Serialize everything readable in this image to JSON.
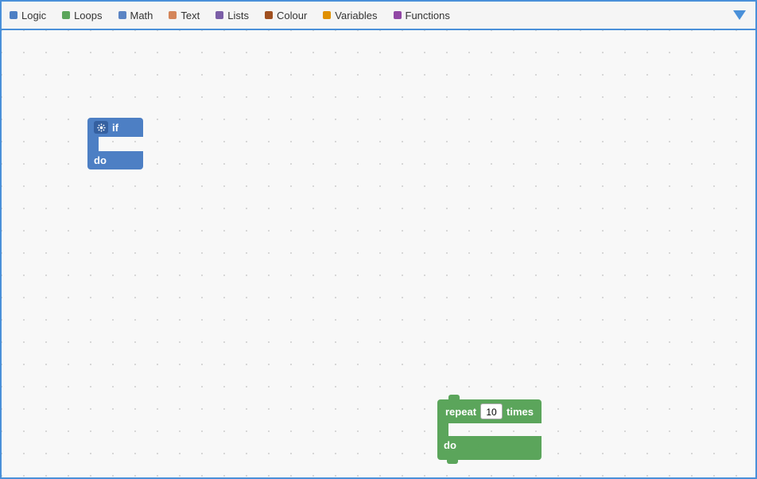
{
  "toolbar": {
    "items": [
      {
        "id": "logic",
        "label": "Logic",
        "color": "#4d7fc4",
        "dotColor": null
      },
      {
        "id": "loops",
        "label": "Loops",
        "color": "#5ba55b",
        "dotColor": "#5ba55b"
      },
      {
        "id": "math",
        "label": "Math",
        "color": "#5b84c4",
        "dotColor": "#5b84c4"
      },
      {
        "id": "text",
        "label": "Text",
        "color": "#a0522d",
        "dotColor": "#d4855a"
      },
      {
        "id": "lists",
        "label": "Lists",
        "color": "#7b5ea7",
        "dotColor": "#7b5ea7"
      },
      {
        "id": "colour",
        "label": "Colour",
        "color": "#a05020",
        "dotColor": "#a05020"
      },
      {
        "id": "variables",
        "label": "Variables",
        "color": "#c47a00",
        "dotColor": "#e09000"
      },
      {
        "id": "functions",
        "label": "Functions",
        "color": "#9147a5",
        "dotColor": "#9147a5"
      }
    ]
  },
  "blocks": {
    "if_block": {
      "top_label": "if",
      "bottom_label": "do"
    },
    "repeat_block": {
      "top_label": "repeat",
      "number_value": "10",
      "times_label": "times",
      "bottom_label": "do"
    }
  },
  "icons": {
    "gear": "⚙",
    "dropdown_arrow": "▼"
  }
}
